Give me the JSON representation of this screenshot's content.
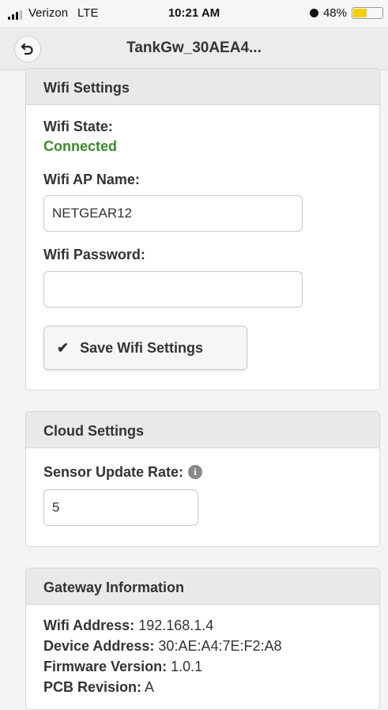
{
  "status_bar": {
    "carrier": "Verizon",
    "network": "LTE",
    "time": "10:21 AM",
    "battery": "48%",
    "battery_level": 0.48
  },
  "header": {
    "title": "TankGw_30AEA4...",
    "back_icon": "back-arrow-icon"
  },
  "wifi": {
    "title": "Wifi Settings",
    "state_label": "Wifi State:",
    "state_value": "Connected",
    "state_color": "#3d8a2b",
    "ap_label": "Wifi AP Name:",
    "ap_value": "NETGEAR12",
    "password_label": "Wifi Password:",
    "password_value": "",
    "save_label": "Save Wifi Settings"
  },
  "cloud": {
    "title": "Cloud Settings",
    "rate_label": "Sensor Update Rate:",
    "rate_value": "5"
  },
  "gateway": {
    "title": "Gateway Information",
    "rows": [
      {
        "label": "Wifi Address:",
        "value": "192.168.1.4"
      },
      {
        "label": "Device Address:",
        "value": "30:AE:A4:7E:F2:A8"
      },
      {
        "label": "Firmware Version:",
        "value": "1.0.1"
      },
      {
        "label": "PCB Revision:",
        "value": "A"
      }
    ]
  }
}
